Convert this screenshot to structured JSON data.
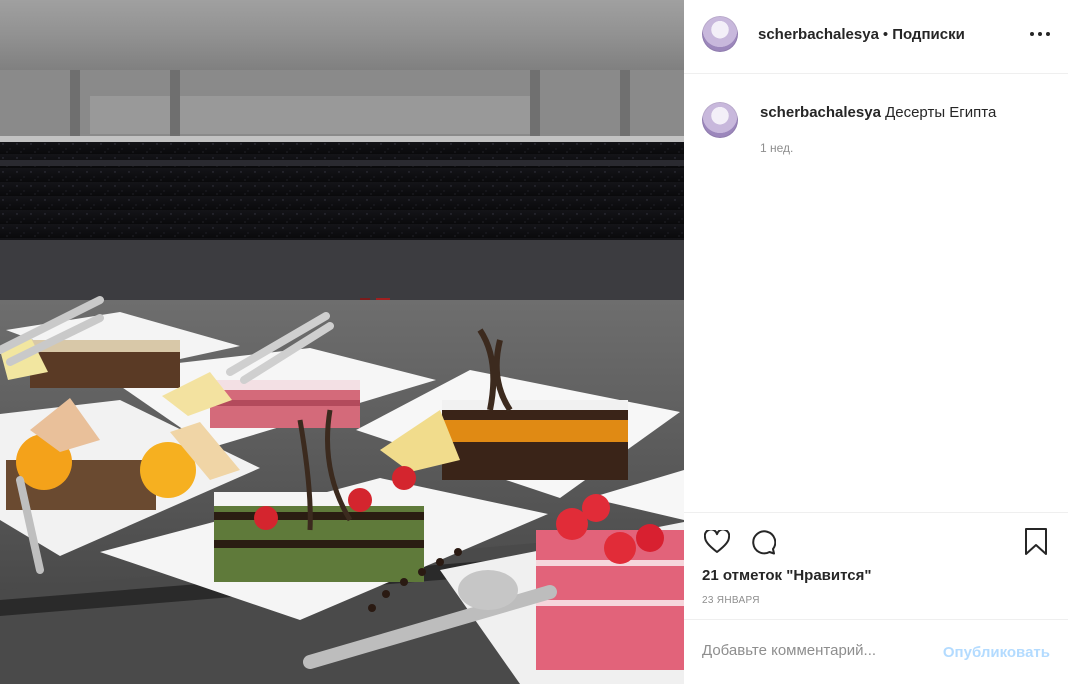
{
  "post": {
    "author": "scherbachalesya",
    "follow_status": "Подписки",
    "separator": "•",
    "caption": "Десерты Египта",
    "caption_time": "1 нед.",
    "likes": "21 отметок \"Нравится\"",
    "date": "23 ЯНВАРЯ"
  },
  "comment": {
    "placeholder": "Добавьте комментарий...",
    "publish_label": "Опубликовать"
  },
  "icons": {
    "more": "more-options-icon",
    "like": "heart-icon",
    "comment": "comment-bubble-icon",
    "save": "bookmark-icon"
  },
  "colors": {
    "text": "#262626",
    "secondary": "#8e8e8e",
    "publish_disabled": "#b3dbff",
    "border": "#efefef"
  }
}
